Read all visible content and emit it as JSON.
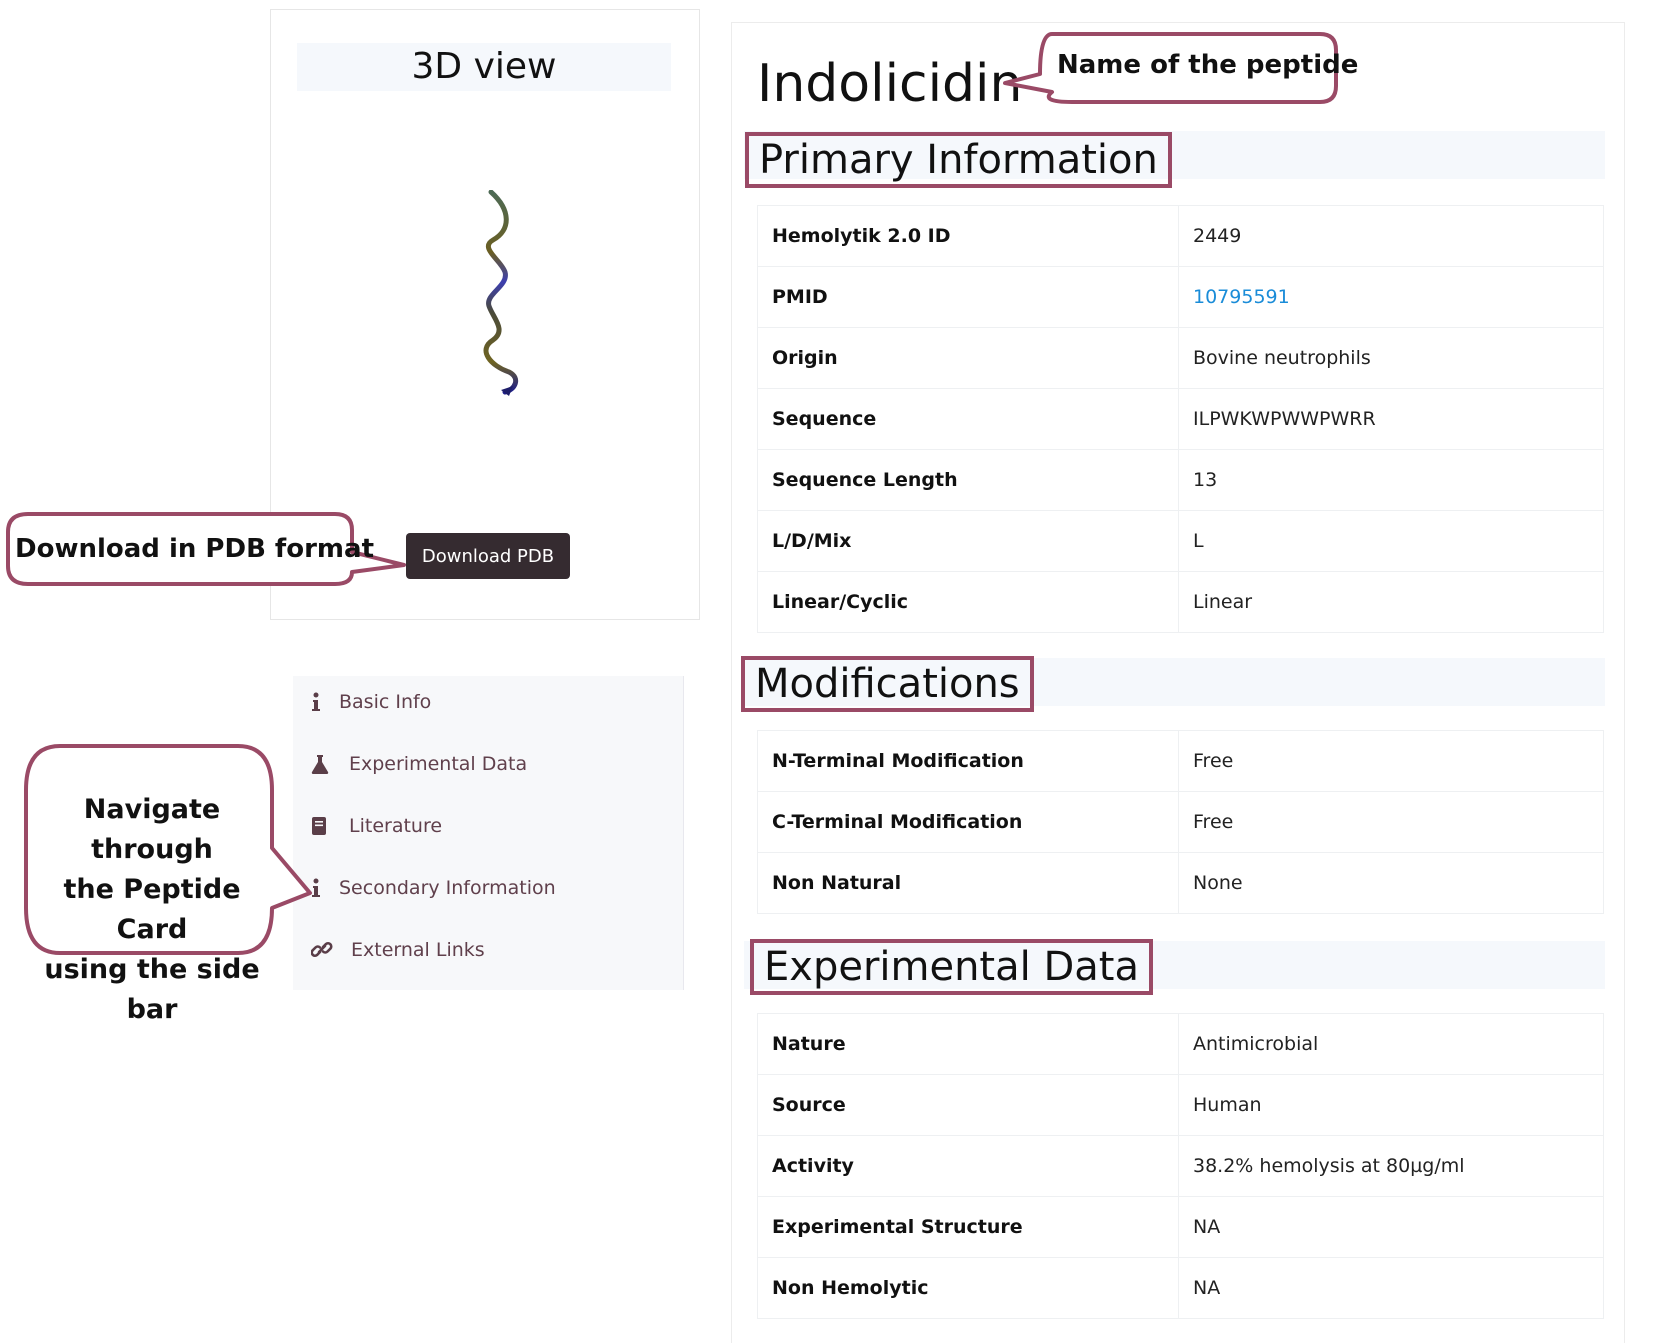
{
  "viewer": {
    "title": "3D view",
    "download_label": "Download PDB"
  },
  "sidebar": {
    "items": [
      {
        "label": "Basic Info",
        "icon": "info-icon"
      },
      {
        "label": "Experimental Data",
        "icon": "flask-icon"
      },
      {
        "label": "Literature",
        "icon": "book-icon"
      },
      {
        "label": "Secondary Information",
        "icon": "info-icon"
      },
      {
        "label": "External Links",
        "icon": "link-icon"
      }
    ]
  },
  "peptide": {
    "name": "Indolicidin"
  },
  "primary": {
    "heading": "Primary Information",
    "rows": [
      {
        "key": "Hemolytik 2.0 ID",
        "value": "2449"
      },
      {
        "key": "PMID",
        "value": "10795591"
      },
      {
        "key": "Origin",
        "value": "Bovine neutrophils"
      },
      {
        "key": "Sequence",
        "value": "ILPWKWPWWPWRR"
      },
      {
        "key": "Sequence Length",
        "value": "13"
      },
      {
        "key": "L/D/Mix",
        "value": "L"
      },
      {
        "key": "Linear/Cyclic",
        "value": "Linear"
      }
    ]
  },
  "modifications": {
    "heading": "Modifications",
    "rows": [
      {
        "key": "N-Terminal Modification",
        "value": "Free"
      },
      {
        "key": "C-Terminal Modification",
        "value": "Free"
      },
      {
        "key": "Non Natural",
        "value": "None"
      }
    ]
  },
  "experimental": {
    "heading": "Experimental Data",
    "rows": [
      {
        "key": "Nature",
        "value": "Antimicrobial"
      },
      {
        "key": "Source",
        "value": "Human"
      },
      {
        "key": "Activity",
        "value": "38.2% hemolysis at 80µg/ml"
      },
      {
        "key": "Experimental Structure",
        "value": "NA"
      },
      {
        "key": "Non Hemolytic",
        "value": "NA"
      }
    ]
  },
  "callouts": {
    "name": "Name of the peptide",
    "download": "Download in PDB format",
    "navigate_1": "Navigate through",
    "navigate_2": "the Peptide Card",
    "navigate_3": "using the side bar"
  },
  "colors": {
    "accent_border": "#9a4a66",
    "button_bg": "#352b30",
    "link": "#1a8cd8",
    "sidebar_text": "#60404c"
  }
}
